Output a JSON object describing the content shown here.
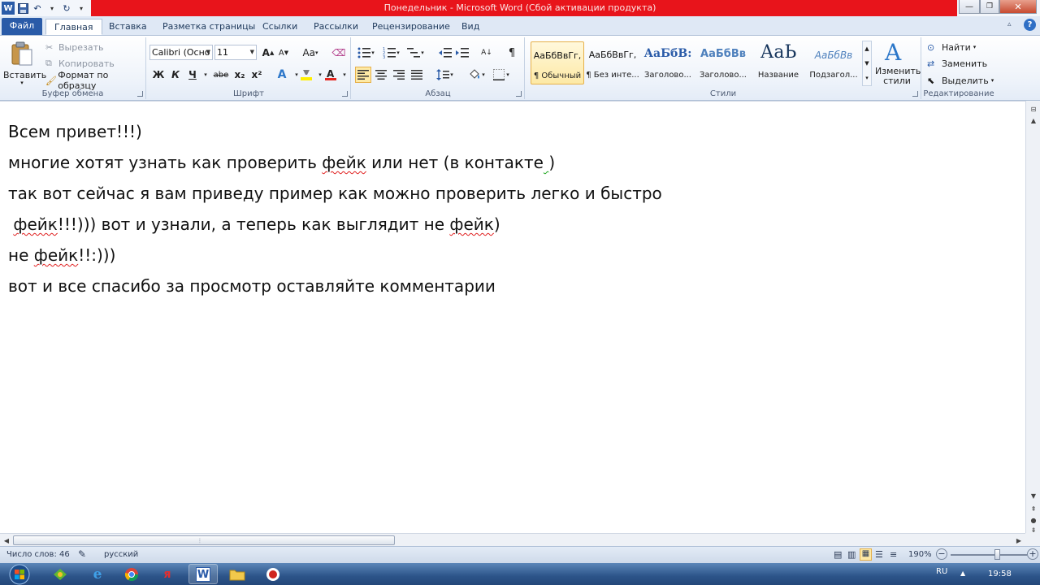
{
  "window": {
    "title": "Понедельник  -  Microsoft Word (Сбой активации продукта)",
    "app_icon": "W"
  },
  "tabs": [
    {
      "label": "Файл"
    },
    {
      "label": "Главная"
    },
    {
      "label": "Вставка"
    },
    {
      "label": "Разметка страницы"
    },
    {
      "label": "Ссылки"
    },
    {
      "label": "Рассылки"
    },
    {
      "label": "Рецензирование"
    },
    {
      "label": "Вид"
    }
  ],
  "ribbon": {
    "clipboard": {
      "paste": "Вставить",
      "cut": "Вырезать",
      "copy": "Копировать",
      "format_painter": "Формат по образцу",
      "label": "Буфер обмена"
    },
    "font": {
      "font_name": "Calibri (Осно",
      "font_size": "11",
      "bold": "Ж",
      "italic": "К",
      "underline": "Ч",
      "strike": "abe",
      "subscript": "x₂",
      "superscript": "x²",
      "grow": "A",
      "shrink": "A",
      "case": "Aa",
      "label": "Шрифт"
    },
    "paragraph": {
      "label": "Абзац"
    },
    "styles": {
      "items": [
        {
          "sample": "АаБбВвГг,",
          "name": "¶ Обычный"
        },
        {
          "sample": "АаБбВвГг,",
          "name": "¶ Без инте..."
        },
        {
          "sample": "АаБбВ:",
          "name": "Заголово..."
        },
        {
          "sample": "АаБбВв",
          "name": "Заголово..."
        },
        {
          "sample": "АаЬ",
          "name": "Название"
        },
        {
          "sample": "АаБбВв",
          "name": "Подзагол..."
        }
      ],
      "change": "Изменить стили",
      "label": "Стили"
    },
    "editing": {
      "find": "Найти",
      "replace": "Заменить",
      "select": "Выделить",
      "label": "Редактирование"
    }
  },
  "document": {
    "lines": [
      {
        "before": "Всем привет!!!)",
        "err": "",
        "after": ""
      },
      {
        "before": "многие хотят узнать как проверить ",
        "err": "фейк",
        "after": " или нет (в контакте",
        "green": " ",
        "tail": ")"
      },
      {
        "before": "так вот сейчас я вам приведу пример как можно проверить легко и быстро",
        "err": "",
        "after": ""
      },
      {
        "before": " ",
        "err": "фейк",
        "after": "!!!))) вот и узнали, а теперь как выглядит не ",
        "err2": "фейк",
        "tail": ")"
      },
      {
        "before": "не ",
        "err": "фейк",
        "after": "!!:)))"
      },
      {
        "before": "вот и все спасибо за просмотр оставляйте комментарии",
        "err": "",
        "after": ""
      }
    ]
  },
  "status": {
    "word_count": "Число слов: 46",
    "language": "русский",
    "zoom": "190%",
    "zoom_level": 0.62
  },
  "tray": {
    "lang": "RU",
    "time": "19:58"
  },
  "colors": {
    "title_accent": "#e8141b",
    "file_tab": "#2a5ba8",
    "taskbar": "#2c5489"
  }
}
